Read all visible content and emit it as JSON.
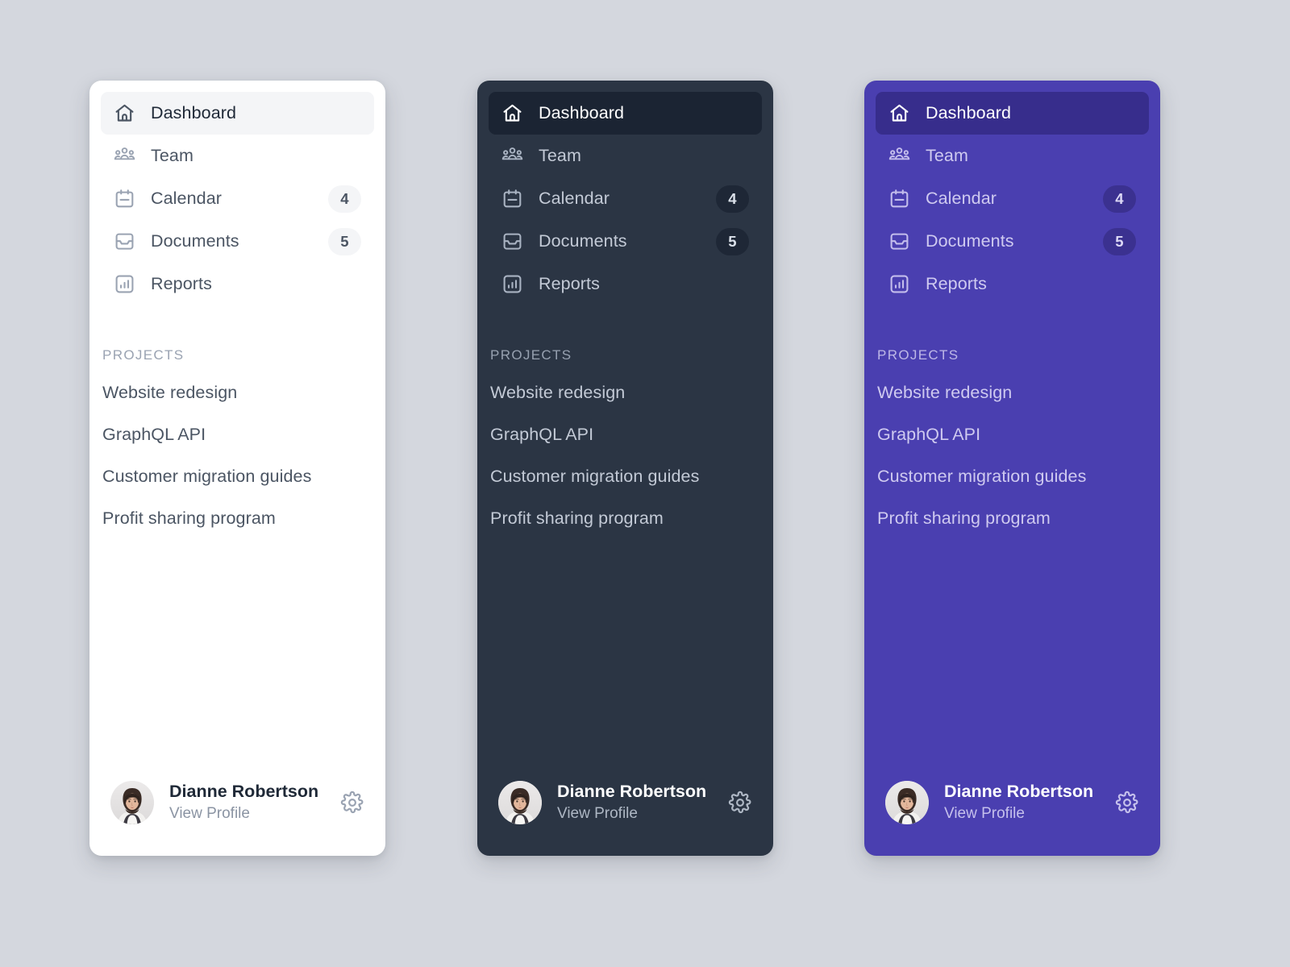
{
  "theme": {
    "page_background": "#d4d7de",
    "panels": [
      {
        "key": "light",
        "name": "light-sidebar",
        "background": "#ffffff",
        "active_background": "#f4f5f7",
        "badge_background": "#f4f5f7",
        "text": "#4b5563"
      },
      {
        "key": "dark",
        "name": "dark-sidebar",
        "background": "#2b3544",
        "active_background": "#1b2433",
        "badge_background": "#1e2736",
        "text": "#c3cad6"
      },
      {
        "key": "purple",
        "name": "purple-sidebar",
        "background": "#4a3fb0",
        "active_background": "#372d8c",
        "badge_background": "#3b3190",
        "text": "#cfcaf0"
      }
    ]
  },
  "nav": {
    "items": [
      {
        "label": "Dashboard",
        "icon": "home-icon",
        "badge": "",
        "active": true
      },
      {
        "label": "Team",
        "icon": "users-icon",
        "badge": "",
        "active": false
      },
      {
        "label": "Calendar",
        "icon": "calendar-icon",
        "badge": "4",
        "active": false
      },
      {
        "label": "Documents",
        "icon": "inbox-icon",
        "badge": "5",
        "active": false
      },
      {
        "label": "Reports",
        "icon": "chart-icon",
        "badge": "",
        "active": false
      }
    ]
  },
  "projects": {
    "heading": "PROJECTS",
    "items": [
      {
        "label": "Website redesign"
      },
      {
        "label": "GraphQL API"
      },
      {
        "label": "Customer migration guides"
      },
      {
        "label": "Profit sharing program"
      }
    ]
  },
  "profile": {
    "name": "Dianne Robertson",
    "subtitle": "View Profile",
    "avatar_icon": "user-avatar-photo",
    "settings_icon": "gear-icon"
  }
}
